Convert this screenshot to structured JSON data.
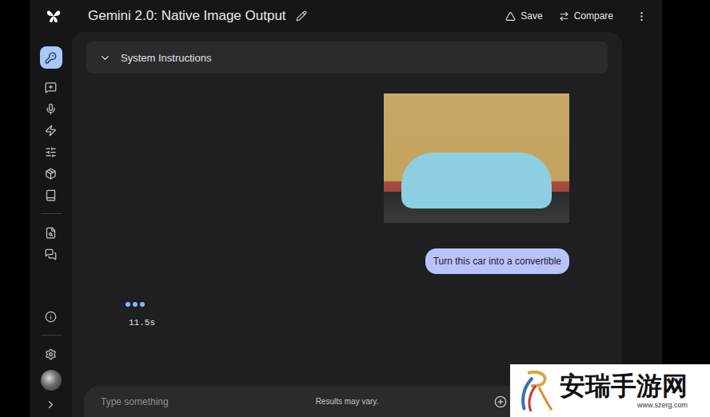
{
  "window": {
    "title": "Gemini 2.0: Native Image Output"
  },
  "header": {
    "buttons": [
      "Save",
      "Compare"
    ]
  },
  "sidebar": {
    "items": [
      {
        "selected": true
      },
      {
        "selected": false
      },
      {
        "selected": false
      },
      {
        "selected": false
      },
      {
        "selected": false
      },
      {
        "selected": false
      },
      {
        "selected": false
      },
      {
        "selected": false
      },
      {
        "selected": false
      }
    ]
  },
  "system_instructions": {
    "label": "System Instructions",
    "expanded": false
  },
  "chat": {
    "messages": [
      {
        "role": "user",
        "kind": "image"
      },
      {
        "role": "user",
        "kind": "text",
        "text": "Turn this car into a convertible"
      }
    ],
    "loading": {
      "elapsed": "11.5s"
    }
  },
  "input": {
    "placeholder": "Type something",
    "note": "Results may vary."
  },
  "watermark": {
    "name": "安瑞手游网",
    "url": "www.szerg.com"
  }
}
